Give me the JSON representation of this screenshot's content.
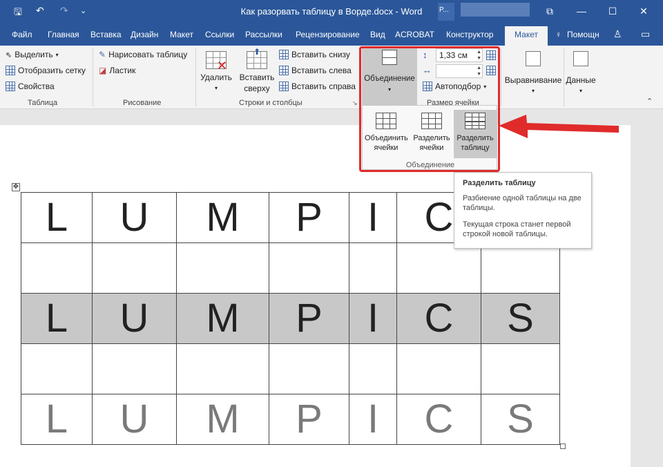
{
  "window": {
    "title": "Как разорвать таблицу в Ворде.docx - Word",
    "user_initial": "P...",
    "buttons": {
      "ribbon_display": "⧉",
      "minimize": "—",
      "maximize": "☐",
      "close": "✕"
    }
  },
  "qat": {
    "save": "🖫",
    "undo": "↶",
    "redo": "↷",
    "customize": "⌄"
  },
  "tabs": [
    "Файл",
    "Главная",
    "Вставка",
    "Дизайн",
    "Макет",
    "Ссылки",
    "Рассылки",
    "Рецензирование",
    "Вид",
    "ACROBAT",
    "Конструктор",
    "Макет"
  ],
  "help": {
    "label": "Помощн",
    "icon": "lightbulb-icon"
  },
  "ribbon": {
    "table_group": {
      "label": "Таблица",
      "select": "Выделить",
      "gridlines": "Отобразить сетку",
      "properties": "Свойства"
    },
    "draw_group": {
      "label": "Рисование",
      "draw_table": "Нарисовать таблицу",
      "eraser": "Ластик"
    },
    "rows_cols_group": {
      "label": "Строки и столбцы",
      "delete": "Удалить",
      "insert_above_1": "Вставить",
      "insert_above_2": "сверху",
      "insert_below": "Вставить снизу",
      "insert_left": "Вставить слева",
      "insert_right": "Вставить справа"
    },
    "merge_group": {
      "label": "Объединение"
    },
    "cell_size_group": {
      "label": "Размер ячейки",
      "height_value": "1,33 см",
      "width_value": "",
      "autofit": "Автоподбор"
    },
    "alignment": "Выравнивание",
    "data": "Данные"
  },
  "merge_panel": {
    "label": "Объединение",
    "merge_cells_1": "Объединить",
    "merge_cells_2": "ячейки",
    "split_cells_1": "Разделить",
    "split_cells_2": "ячейки",
    "split_table_1": "Разделить",
    "split_table_2": "таблицу"
  },
  "tooltip": {
    "title": "Разделить таблицу",
    "line1": "Разбиение одной таблицы на две таблицы.",
    "line2": "Текущая строка станет первой строкой новой таблицы."
  },
  "document_table": {
    "rows": [
      [
        "L",
        "U",
        "M",
        "P",
        "I",
        "C",
        ""
      ],
      [
        "",
        "",
        "",
        "",
        "",
        "",
        ""
      ],
      [
        "L",
        "U",
        "M",
        "P",
        "I",
        "C",
        "S"
      ],
      [
        "",
        "",
        "",
        "",
        "",
        "",
        ""
      ],
      [
        "L",
        "U",
        "M",
        "P",
        "I",
        "C",
        "S"
      ]
    ]
  },
  "colors": {
    "ribbon_blue": "#2b579a",
    "highlight_red": "#e02b2b",
    "selected_row": "#c8c8c8"
  }
}
